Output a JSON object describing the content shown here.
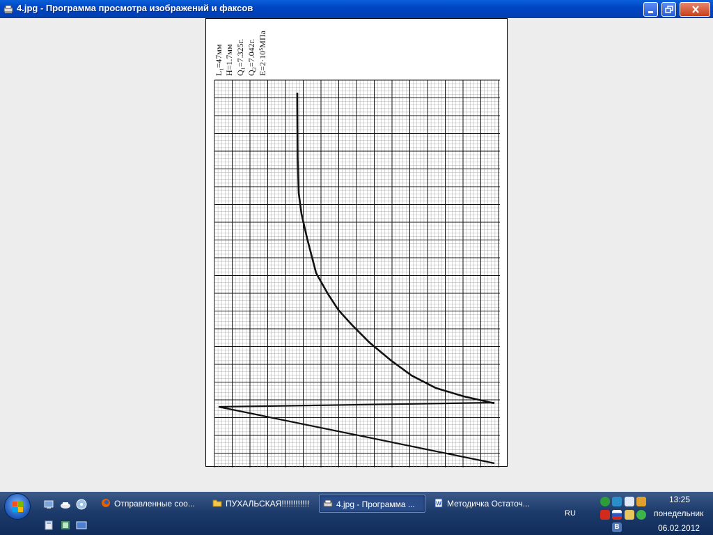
{
  "window": {
    "title": "4.jpg - Программа просмотра изображений и факсов"
  },
  "image": {
    "labels": {
      "l": "L₁=47мм",
      "h": "H=1.7мм",
      "q1": "Q₁=7.325г.",
      "q2": "Q₂=7.042г.",
      "e": "E=2·10⁵МПа"
    }
  },
  "toolbar": {
    "icons": [
      "previous-image-icon",
      "next-image-icon",
      "best-fit-icon",
      "actual-size-icon",
      "slideshow-icon",
      "zoom-in-icon",
      "zoom-out-icon",
      "rotate-clockwise-icon",
      "rotate-counterclockwise-icon",
      "delete-icon",
      "print-icon",
      "save-icon",
      "edit-icon",
      "help-icon"
    ]
  },
  "taskbar": {
    "tasks": [
      {
        "label": "Отправленные соо...",
        "icon": "firefox-icon"
      },
      {
        "label": "ПУХАЛЬСКАЯ!!!!!!!!!!!!",
        "icon": "folder-icon"
      },
      {
        "label": "4.jpg - Программа ...",
        "icon": "image-viewer-icon"
      },
      {
        "label": "Методичка Остаточ...",
        "icon": "word-icon"
      }
    ],
    "language": "RU",
    "clock": {
      "time": "13:25",
      "day": "понедельник",
      "date": "06.02.2012"
    },
    "tray_badge": "В"
  },
  "colors": {
    "titlebar": "#0046c4",
    "taskbar": "#1d3b6b",
    "background": "#ededed"
  }
}
